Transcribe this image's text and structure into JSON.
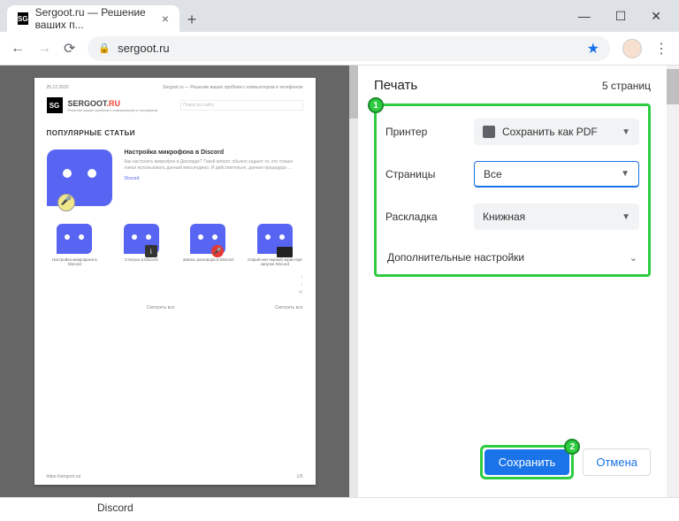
{
  "window": {
    "min": "—",
    "max": "☐",
    "close": "✕"
  },
  "tab": {
    "favicon": "SG",
    "title": "Sergoot.ru — Решение ваших п..."
  },
  "url": {
    "host": "sergoot.ru"
  },
  "preview": {
    "date": "25.12.2020",
    "header": "Sergoot.ru — Решение ваших проблем с компьютером и телефоном",
    "logo_main": "SERGOOT",
    "logo_suffix": ".RU",
    "logo_sub": "Решение ваших проблем с компьютером и телефоном",
    "search_placeholder": "Поиск по сайту",
    "section": "ПОПУЛЯРНЫЕ СТАТЬИ",
    "feat": {
      "title": "Настройка микрофона в Discord",
      "desc": "Как настроить микрофон в Дискорде? Такой вопрос обычно задают те, кто только начал использовать данный мессенджер. И действительно, данная процедура …",
      "tag": "Discord"
    },
    "thumbs": [
      {
        "cap": "Настройка микрофона в Discord"
      },
      {
        "cap": "Статусы в Discord"
      },
      {
        "cap": "Запись разговора в Discord"
      },
      {
        "cap": "Серый или черный экран при запуске Discord"
      }
    ],
    "see_all": "Смотреть все",
    "footer_url": "https://sergoot.ru/",
    "footer_page": "1/5"
  },
  "print": {
    "title": "Печать",
    "count": "5 страниц",
    "rows": {
      "printer_label": "Принтер",
      "printer_value": "Сохранить как PDF",
      "pages_label": "Страницы",
      "pages_value": "Все",
      "layout_label": "Раскладка",
      "layout_value": "Книжная",
      "more": "Дополнительные настройки"
    },
    "save": "Сохранить",
    "cancel": "Отмена"
  },
  "peek": "Discord"
}
